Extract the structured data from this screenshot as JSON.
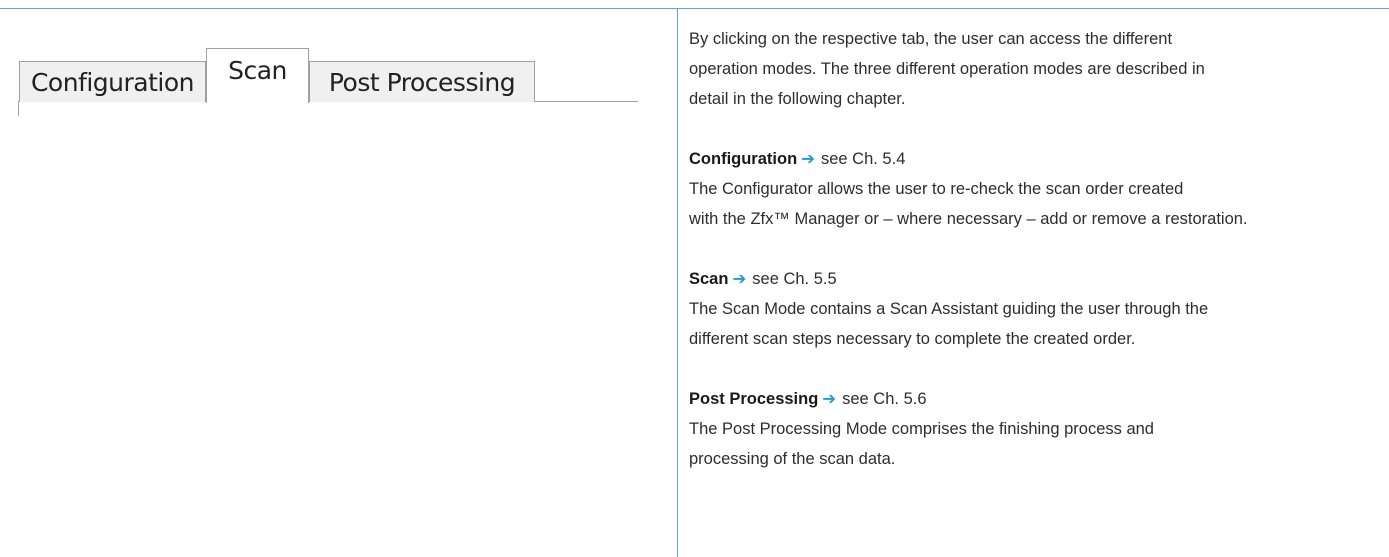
{
  "tabs": [
    {
      "label": "Configuration",
      "selected": false
    },
    {
      "label": "Scan",
      "selected": true
    },
    {
      "label": "Post Processing",
      "selected": false
    }
  ],
  "intro": "By clicking on the respective tab, the user can access the different\noperation modes. The three different operation modes are described in\ndetail in the following chapter.",
  "sections": [
    {
      "title": "Configuration",
      "arrow": "➔",
      "ref": "see Ch. 5.4",
      "body": "The Configurator allows the user to re-check the scan order created\nwith the Zfx™ Manager or – where necessary – add or remove a restoration."
    },
    {
      "title": "Scan",
      "arrow": "➔",
      "ref": "see Ch. 5.5",
      "body": "The Scan Mode contains a Scan Assistant guiding the user through the\ndifferent scan steps necessary to complete the created order."
    },
    {
      "title": "Post Processing",
      "arrow": "➔",
      "ref": "see Ch. 5.6",
      "body": "The Post Processing Mode comprises the finishing process and\nprocessing of the scan data."
    }
  ],
  "colors": {
    "rule": "#5aa9d2",
    "arrow": "#1e9ad6"
  }
}
